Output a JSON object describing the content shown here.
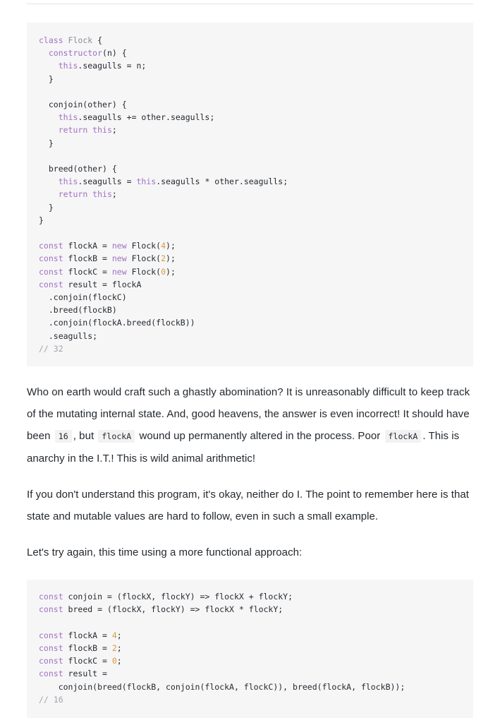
{
  "page": {
    "divider": "horizontal-rule"
  },
  "code_block_1": {
    "language": "javascript",
    "lines": [
      [
        {
          "t": "class ",
          "c": "kw"
        },
        {
          "t": "Flock ",
          "c": "type"
        },
        {
          "t": "{",
          "c": "plain"
        }
      ],
      [
        {
          "t": "  ",
          "c": "plain"
        },
        {
          "t": "constructor",
          "c": "fn"
        },
        {
          "t": "(n) {",
          "c": "plain"
        }
      ],
      [
        {
          "t": "    ",
          "c": "plain"
        },
        {
          "t": "this",
          "c": "kw"
        },
        {
          "t": ".seagulls = n;",
          "c": "plain"
        }
      ],
      [
        {
          "t": "  }",
          "c": "plain"
        }
      ],
      [
        {
          "t": "",
          "c": "plain"
        }
      ],
      [
        {
          "t": "  conjoin(other) {",
          "c": "plain"
        }
      ],
      [
        {
          "t": "    ",
          "c": "plain"
        },
        {
          "t": "this",
          "c": "kw"
        },
        {
          "t": ".seagulls += other.seagulls;",
          "c": "plain"
        }
      ],
      [
        {
          "t": "    ",
          "c": "plain"
        },
        {
          "t": "return ",
          "c": "kw"
        },
        {
          "t": "this",
          "c": "kw"
        },
        {
          "t": ";",
          "c": "plain"
        }
      ],
      [
        {
          "t": "  }",
          "c": "plain"
        }
      ],
      [
        {
          "t": "",
          "c": "plain"
        }
      ],
      [
        {
          "t": "  breed(other) {",
          "c": "plain"
        }
      ],
      [
        {
          "t": "    ",
          "c": "plain"
        },
        {
          "t": "this",
          "c": "kw"
        },
        {
          "t": ".seagulls = ",
          "c": "plain"
        },
        {
          "t": "this",
          "c": "kw"
        },
        {
          "t": ".seagulls * other.seagulls;",
          "c": "plain"
        }
      ],
      [
        {
          "t": "    ",
          "c": "plain"
        },
        {
          "t": "return ",
          "c": "kw"
        },
        {
          "t": "this",
          "c": "kw"
        },
        {
          "t": ";",
          "c": "plain"
        }
      ],
      [
        {
          "t": "  }",
          "c": "plain"
        }
      ],
      [
        {
          "t": "}",
          "c": "plain"
        }
      ],
      [
        {
          "t": "",
          "c": "plain"
        }
      ],
      [
        {
          "t": "const ",
          "c": "kw"
        },
        {
          "t": "flockA = ",
          "c": "plain"
        },
        {
          "t": "new ",
          "c": "kw"
        },
        {
          "t": "Flock(",
          "c": "plain"
        },
        {
          "t": "4",
          "c": "num"
        },
        {
          "t": ");",
          "c": "plain"
        }
      ],
      [
        {
          "t": "const ",
          "c": "kw"
        },
        {
          "t": "flockB = ",
          "c": "plain"
        },
        {
          "t": "new ",
          "c": "kw"
        },
        {
          "t": "Flock(",
          "c": "plain"
        },
        {
          "t": "2",
          "c": "num"
        },
        {
          "t": ");",
          "c": "plain"
        }
      ],
      [
        {
          "t": "const ",
          "c": "kw"
        },
        {
          "t": "flockC = ",
          "c": "plain"
        },
        {
          "t": "new ",
          "c": "kw"
        },
        {
          "t": "Flock(",
          "c": "plain"
        },
        {
          "t": "0",
          "c": "num"
        },
        {
          "t": ");",
          "c": "plain"
        }
      ],
      [
        {
          "t": "const ",
          "c": "kw"
        },
        {
          "t": "result = flockA",
          "c": "plain"
        }
      ],
      [
        {
          "t": "  .conjoin(flockC)",
          "c": "plain"
        }
      ],
      [
        {
          "t": "  .breed(flockB)",
          "c": "plain"
        }
      ],
      [
        {
          "t": "  .conjoin(flockA.breed(flockB))",
          "c": "plain"
        }
      ],
      [
        {
          "t": "  .seagulls;",
          "c": "plain"
        }
      ],
      [
        {
          "t": "// 32",
          "c": "com"
        }
      ]
    ]
  },
  "paragraph_1": {
    "parts": [
      {
        "type": "text",
        "value": "Who on earth would craft such a ghastly abomination? It is unreasonably difficult to keep track of the mutating internal state. And, good heavens, the answer is even incorrect! It should have been "
      },
      {
        "type": "code",
        "value": "16"
      },
      {
        "type": "text",
        "value": ", but "
      },
      {
        "type": "code",
        "value": "flockA"
      },
      {
        "type": "text",
        "value": " wound up permanently altered in the process. Poor "
      },
      {
        "type": "code",
        "value": "flockA"
      },
      {
        "type": "text",
        "value": ". This is anarchy in the I.T.! This is wild animal arithmetic!"
      }
    ]
  },
  "paragraph_2": {
    "text": "If you don't understand this program, it's okay, neither do I. The point to remember here is that state and mutable values are hard to follow, even in such a small example."
  },
  "paragraph_3": {
    "text": "Let's try again, this time using a more functional approach:"
  },
  "code_block_2": {
    "language": "javascript",
    "lines": [
      [
        {
          "t": "const ",
          "c": "kw"
        },
        {
          "t": "conjoin = (flockX, flockY) => flockX + flockY;",
          "c": "plain"
        }
      ],
      [
        {
          "t": "const ",
          "c": "kw"
        },
        {
          "t": "breed = (flockX, flockY) => flockX * flockY;",
          "c": "plain"
        }
      ],
      [
        {
          "t": "",
          "c": "plain"
        }
      ],
      [
        {
          "t": "const ",
          "c": "kw"
        },
        {
          "t": "flockA = ",
          "c": "plain"
        },
        {
          "t": "4",
          "c": "num"
        },
        {
          "t": ";",
          "c": "plain"
        }
      ],
      [
        {
          "t": "const ",
          "c": "kw"
        },
        {
          "t": "flockB = ",
          "c": "plain"
        },
        {
          "t": "2",
          "c": "num"
        },
        {
          "t": ";",
          "c": "plain"
        }
      ],
      [
        {
          "t": "const ",
          "c": "kw"
        },
        {
          "t": "flockC = ",
          "c": "plain"
        },
        {
          "t": "0",
          "c": "num"
        },
        {
          "t": ";",
          "c": "plain"
        }
      ],
      [
        {
          "t": "const ",
          "c": "kw"
        },
        {
          "t": "result =",
          "c": "plain"
        }
      ],
      [
        {
          "t": "    conjoin(breed(flockB, conjoin(flockA, flockC)), breed(flockA, flockB));",
          "c": "plain"
        }
      ],
      [
        {
          "t": "// 16",
          "c": "com"
        }
      ]
    ]
  },
  "colors": {
    "code_bg": "#f6f6f7",
    "inline_code_bg": "#f2f2f3",
    "keyword": "#a071c0",
    "type": "#8a8f98",
    "function": "#9a6fc4",
    "number": "#d99a3e",
    "comment": "#a0a4ab",
    "text": "#24292e",
    "rule": "#e4e4e4"
  }
}
